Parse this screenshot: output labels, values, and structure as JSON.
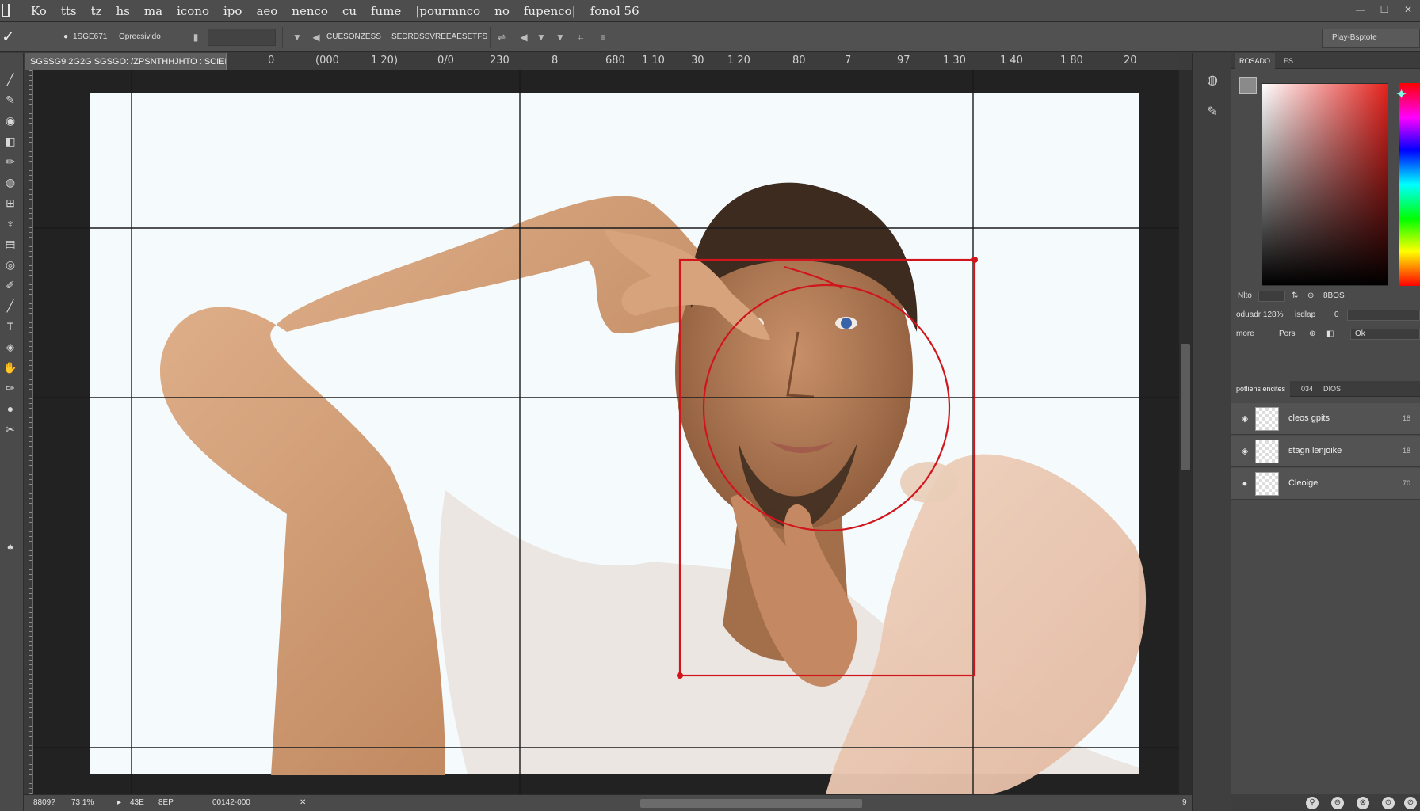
{
  "menubar": {
    "items": [
      "Ko",
      "tts",
      "tz",
      "hs",
      "ma",
      "icono",
      "ipo",
      "aeo",
      "nenco",
      "cu",
      "fume",
      "|pourmnco",
      "no",
      "fupenco|",
      "fonol 56"
    ],
    "window_controls": [
      "—",
      "☐",
      "✕"
    ]
  },
  "options": {
    "preset_label": "1SGE671",
    "mode_label": "Oprecsivido",
    "combo_label": "CUESONZESS",
    "align_label": "SEDRDSSVREEAESETFS",
    "workspace_label": "Play-Bsptote"
  },
  "document": {
    "tab_title": "SGSSG9 2G2G SGSGO: /ZPSNTHHJHTO : SCIEE",
    "ruler_ticks": [
      "0",
      "(000",
      "1 20)",
      "0/0",
      "230",
      "8",
      "680",
      "1 10",
      "30",
      "1 20",
      "80",
      "7",
      "97",
      "1 30",
      "1 40",
      "1 80",
      "20"
    ]
  },
  "status": {
    "doc_size": "8809?",
    "zoom": "73 1%",
    "arrow_label": "▸",
    "pos_x": "43E",
    "pos_y": "8EP",
    "info": "00142-000",
    "close_label": "✕",
    "corner": "9"
  },
  "color_panel": {
    "tab_active": "ROSADO",
    "tab_second": "ES",
    "field_color": "#e4231e"
  },
  "properties": {
    "row1": {
      "label": "Nlto",
      "value": "8BOS"
    },
    "row2": {
      "label": "oduadr 128%",
      "label2": "isdlap",
      "value": "0"
    },
    "row3": {
      "label": "more",
      "label2": "Pors",
      "value": "Ok"
    }
  },
  "layers": {
    "tabs": [
      "potliens encites",
      "034",
      "DIOS"
    ],
    "rows": [
      {
        "name": "cleos gpits",
        "num": "18"
      },
      {
        "name": "stagn lenjoike",
        "num": "18"
      },
      {
        "name": "Cleoige",
        "num": "70"
      }
    ]
  },
  "colors": {
    "guide_red": "#d0161c",
    "accent_cyan": "#7fffe8"
  },
  "icons": {
    "tools": [
      "brush-icon",
      "pen-icon",
      "spot-heal-icon",
      "eraser-icon",
      "pencil-icon",
      "mixer-brush-icon",
      "stamp-icon",
      "history-brush-icon",
      "blur-icon",
      "dodge-icon",
      "lasso-icon",
      "smudge-icon",
      "type-icon",
      "shape-icon",
      "hand-icon",
      "eyedropper-icon",
      "zoom-icon",
      "crop-icon",
      "move-icon"
    ],
    "dock": [
      "color-dock-icon",
      "brush-settings-icon"
    ]
  }
}
